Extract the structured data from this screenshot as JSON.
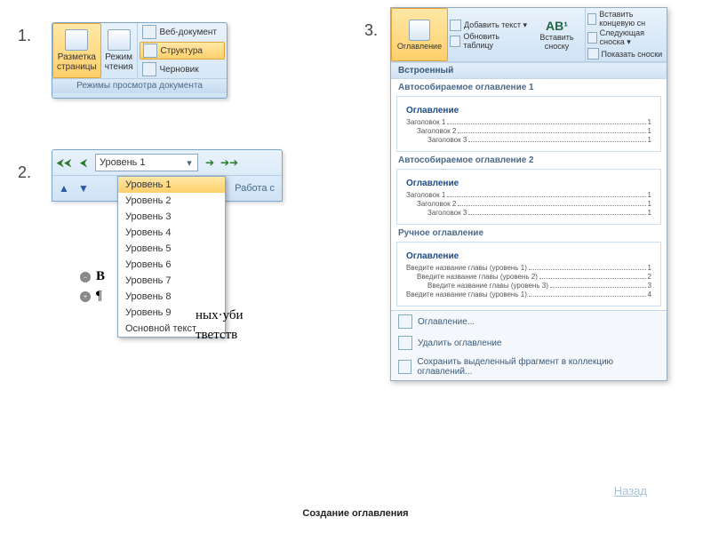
{
  "numbers": {
    "one": "1.",
    "two": "2.",
    "three": "3."
  },
  "panel1": {
    "big": [
      {
        "label": "Разметка\nстраницы",
        "selected": true
      },
      {
        "label": "Режим\nчтения",
        "selected": false
      }
    ],
    "small": [
      {
        "label": "Веб-документ",
        "selected": false
      },
      {
        "label": "Структура",
        "selected": true
      },
      {
        "label": "Черновик",
        "selected": false
      }
    ],
    "caption": "Режимы просмотра документа"
  },
  "panel2": {
    "combo_value": "Уровень 1",
    "work_label": "Работа с",
    "levels": [
      "Уровень 1",
      "Уровень 2",
      "Уровень 3",
      "Уровень 4",
      "Уровень 5",
      "Уровень 6",
      "Уровень 7",
      "Уровень 8",
      "Уровень 9",
      "Основной текст"
    ],
    "selected_index": 0
  },
  "doc_fragment": {
    "line1": "В",
    "line2": "¶",
    "line3_tail": "ных·уби",
    "line4_tail": "тветств"
  },
  "panel3": {
    "ribbon": {
      "toc_btn": "Оглавление",
      "add_text": "Добавить текст ▾",
      "update": "Обновить таблицу",
      "ab_label": "AB¹",
      "insert_footnote": "Вставить\nсноску",
      "end_note": "Вставить концевую сн",
      "next_note": "Следующая сноска ▾",
      "show_notes": "Показать сноски"
    },
    "builtin_header": "Встроенный",
    "previews": [
      {
        "title": "Автособираемое оглавление 1",
        "heading": "Оглавление",
        "lines": [
          {
            "t": "Заголовок 1",
            "p": "1",
            "lvl": 1
          },
          {
            "t": "Заголовок 2",
            "p": "1",
            "lvl": 2
          },
          {
            "t": "Заголовок 3",
            "p": "1",
            "lvl": 3
          }
        ]
      },
      {
        "title": "Автособираемое оглавление 2",
        "heading": "Оглавление",
        "lines": [
          {
            "t": "Заголовок 1",
            "p": "1",
            "lvl": 1
          },
          {
            "t": "Заголовок 2",
            "p": "1",
            "lvl": 2
          },
          {
            "t": "Заголовок 3",
            "p": "1",
            "lvl": 3
          }
        ]
      },
      {
        "title": "Ручное оглавление",
        "heading": "Оглавление",
        "lines": [
          {
            "t": "Введите название главы (уровень 1)",
            "p": "1",
            "lvl": 1
          },
          {
            "t": "Введите название главы (уровень 2)",
            "p": "2",
            "lvl": 2
          },
          {
            "t": "Введите название главы (уровень 3)",
            "p": "3",
            "lvl": 3
          },
          {
            "t": "Введите название главы (уровень 1)",
            "p": "4",
            "lvl": 1
          }
        ]
      }
    ],
    "menu": [
      "Оглавление...",
      "Удалить оглавление",
      "Сохранить выделенный фрагмент в коллекцию оглавлений..."
    ]
  },
  "footer": {
    "title": "Создание оглавления",
    "back": "Назад"
  }
}
